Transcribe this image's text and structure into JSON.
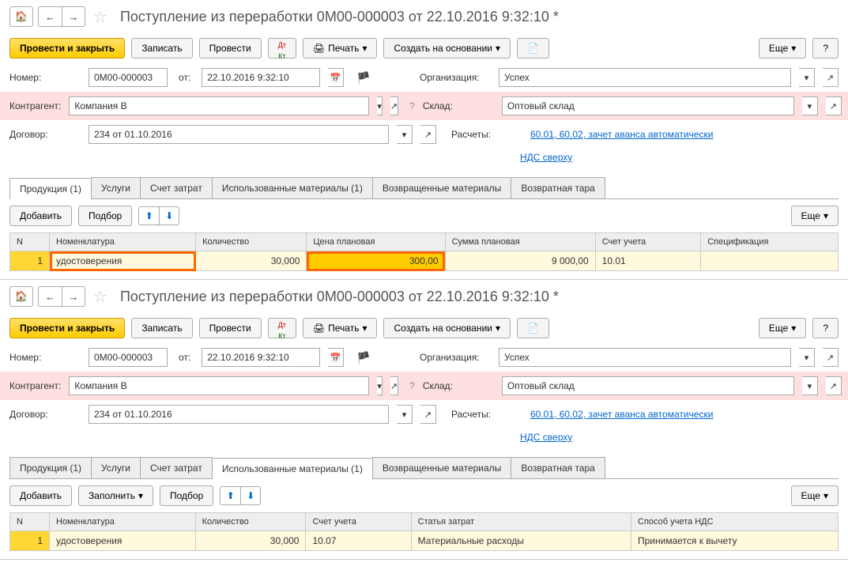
{
  "doc1": {
    "title": "Поступление из переработки 0М00-000003 от 22.10.2016 9:32:10 *",
    "toolbar": {
      "post_close": "Провести и закрыть",
      "save": "Записать",
      "post": "Провести",
      "print": "Печать",
      "create_based": "Создать на основании",
      "more": "Еще"
    },
    "fields": {
      "number_label": "Номер:",
      "number_value": "0М00-000003",
      "from_label": "от:",
      "date_value": "22.10.2016  9:32:10",
      "org_label": "Организация:",
      "org_value": "Успех",
      "counterparty_label": "Контрагент:",
      "counterparty_value": "Компания В",
      "warehouse_label": "Склад:",
      "warehouse_value": "Оптовый склад",
      "contract_label": "Договор:",
      "contract_value": "234 от 01.10.2016",
      "settlements_label": "Расчеты:",
      "settlements_value": "60.01, 60.02, зачет аванса автоматически",
      "vat_value": "НДС сверху"
    },
    "tabs": {
      "products": "Продукция (1)",
      "services": "Услуги",
      "cost_account": "Счет затрат",
      "used_materials": "Использованные материалы (1)",
      "returned_materials": "Возвращенные материалы",
      "returnable_packaging": "Возвратная тара"
    },
    "table_toolbar": {
      "add": "Добавить",
      "select": "Подбор",
      "more": "Еще"
    },
    "table": {
      "headers": {
        "n": "N",
        "nomenclature": "Номенклатура",
        "quantity": "Количество",
        "planned_price": "Цена плановая",
        "planned_sum": "Сумма плановая",
        "account": "Счет учета",
        "spec": "Спецификация"
      },
      "row1": {
        "n": "1",
        "nomenclature": "удостоверения",
        "quantity": "30,000",
        "price": "300,00",
        "sum": "9 000,00",
        "account": "10.01"
      }
    }
  },
  "doc2": {
    "title": "Поступление из переработки 0М00-000003 от 22.10.2016 9:32:10 *",
    "table_toolbar": {
      "add": "Добавить",
      "fill": "Заполнить",
      "select": "Подбор",
      "more": "Еще"
    },
    "table": {
      "headers": {
        "n": "N",
        "nomenclature": "Номенклатура",
        "quantity": "Количество",
        "account": "Счет учета",
        "cost_item": "Статья затрат",
        "vat_method": "Способ учета НДС"
      },
      "row1": {
        "n": "1",
        "nomenclature": "удостоверения",
        "quantity": "30,000",
        "account": "10.07",
        "cost_item": "Материальные расходы",
        "vat_method": "Принимается к вычету"
      }
    }
  }
}
